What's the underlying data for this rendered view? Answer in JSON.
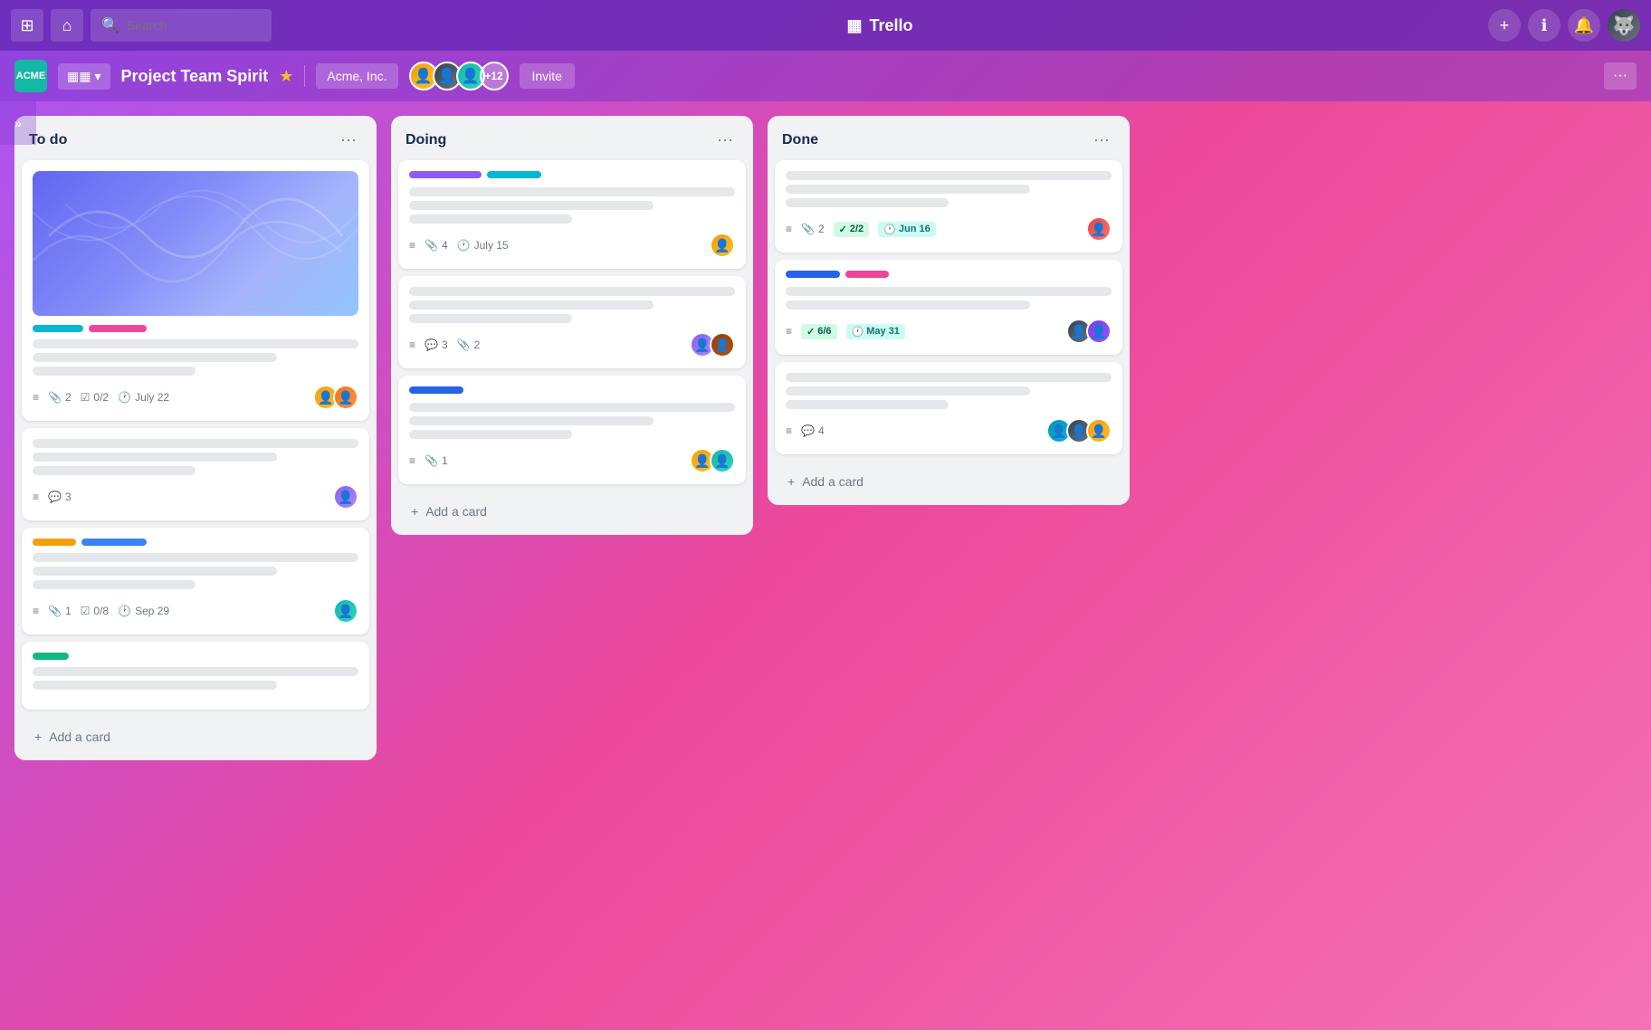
{
  "app": {
    "name": "Trello",
    "logo": "▦"
  },
  "nav": {
    "search_placeholder": "Search",
    "grid_icon": "⊞",
    "home_icon": "⌂",
    "search_icon": "🔍",
    "plus_icon": "+",
    "info_icon": "ℹ",
    "bell_icon": "🔔",
    "more_icon": "···"
  },
  "board": {
    "workspace_label": "ACME",
    "board_type_icon": "▦",
    "title": "Project Team Spirit",
    "star_icon": "★",
    "workspace_name": "Acme, Inc.",
    "member_count": "+12",
    "invite_label": "Invite",
    "more_label": "···"
  },
  "sidebar": {
    "toggle": "»"
  },
  "lists": [
    {
      "id": "todo",
      "title": "To do",
      "menu_icon": "···",
      "cards": [
        {
          "id": "card-1",
          "has_image": true,
          "tags": [
            "cyan",
            "pink"
          ],
          "lines": [
            "full",
            "medium",
            "short"
          ],
          "footer": {
            "hamburger": true,
            "attachments": "2",
            "checklist": "0/2",
            "due_date": "July 22"
          },
          "avatars": [
            "yellow",
            "orange"
          ]
        },
        {
          "id": "card-2",
          "has_image": false,
          "tags": [],
          "lines": [
            "full",
            "medium",
            "short"
          ],
          "footer": {
            "hamburger": true,
            "comments": "3"
          },
          "avatars": [
            "purple"
          ]
        },
        {
          "id": "card-3",
          "has_image": false,
          "tags": [
            "yellow",
            "blue-mid"
          ],
          "lines": [
            "full",
            "medium",
            "short"
          ],
          "footer": {
            "hamburger": true,
            "attachments": "1",
            "checklist": "0/8",
            "due_date": "Sep 29"
          },
          "avatars": [
            "teal"
          ]
        },
        {
          "id": "card-4",
          "has_image": false,
          "tags": [
            "green"
          ],
          "lines": [
            "full",
            "medium"
          ],
          "footer": {},
          "avatars": []
        }
      ],
      "add_card_label": "+ Add a card"
    },
    {
      "id": "doing",
      "title": "Doing",
      "menu_icon": "···",
      "cards": [
        {
          "id": "doing-1",
          "has_image": false,
          "progress_bars": [
            "purple",
            "cyan"
          ],
          "lines": [
            "full",
            "medium",
            "short"
          ],
          "footer": {
            "hamburger": true,
            "attachments": "4",
            "due_date": "July 15"
          },
          "avatars": [
            "yellow"
          ]
        },
        {
          "id": "doing-2",
          "has_image": false,
          "tags": [],
          "lines": [
            "full",
            "medium",
            "short"
          ],
          "footer": {
            "hamburger": true,
            "comments": "3",
            "attachments": "2"
          },
          "avatars": [
            "purple",
            "brown"
          ]
        },
        {
          "id": "doing-3",
          "has_image": false,
          "progress_bars": [
            "blue-dark"
          ],
          "lines": [
            "full",
            "medium",
            "short"
          ],
          "footer": {
            "hamburger": true,
            "attachments": "1"
          },
          "avatars": [
            "yellow",
            "teal"
          ]
        }
      ],
      "add_card_label": "+ Add a card"
    },
    {
      "id": "done",
      "title": "Done",
      "menu_icon": "···",
      "cards": [
        {
          "id": "done-1",
          "has_image": false,
          "tags": [],
          "lines": [
            "full",
            "medium",
            "short"
          ],
          "footer": {
            "hamburger": true,
            "attachments": "2",
            "badge_22": "2/2",
            "badge_date": "Jun 16"
          },
          "avatars": [
            "red"
          ]
        },
        {
          "id": "done-2",
          "has_image": false,
          "progress_bars": [
            "blue-dark",
            "pink"
          ],
          "lines": [
            "full",
            "medium"
          ],
          "footer": {
            "hamburger": true,
            "badge_66": "6/6",
            "badge_date2": "May 31"
          },
          "avatars": [
            "dark",
            "mauve"
          ]
        },
        {
          "id": "done-3",
          "has_image": false,
          "tags": [],
          "lines": [
            "full",
            "medium",
            "short"
          ],
          "footer": {
            "hamburger": true,
            "comments": "4"
          },
          "avatars": [
            "cyan",
            "dark",
            "yellow"
          ]
        }
      ],
      "add_card_label": "+ Add a card"
    }
  ]
}
